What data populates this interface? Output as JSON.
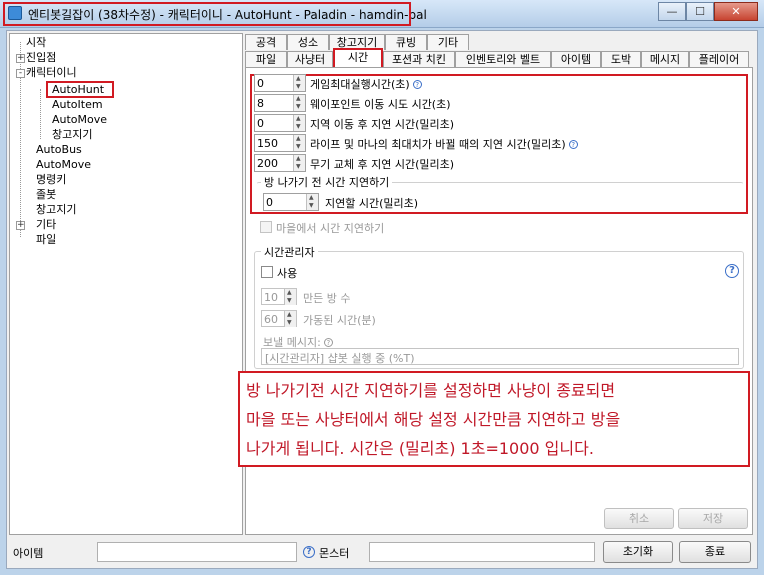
{
  "window": {
    "title": "엔티봇길잡이 (38차수정) - 캐릭터이니 - AutoHunt - Paladin - hamdin-pal",
    "min_label": "—",
    "max_label": "☐",
    "close_label": "✕"
  },
  "tree": {
    "items": [
      {
        "label": "시작"
      },
      {
        "label": "진입점",
        "expander": "+"
      },
      {
        "label": "캐릭터이니",
        "expander": "-"
      },
      {
        "label": "AutoHunt"
      },
      {
        "label": "AutoItem"
      },
      {
        "label": "AutoMove"
      },
      {
        "label": "창고지기"
      },
      {
        "label": "AutoBus"
      },
      {
        "label": "AutoMove"
      },
      {
        "label": "명령키"
      },
      {
        "label": "졸봇"
      },
      {
        "label": "창고지기"
      },
      {
        "label": "기타",
        "expander": "+"
      },
      {
        "label": "파일"
      }
    ]
  },
  "tabs": {
    "row1": [
      "공격",
      "성소",
      "창고지기",
      "큐빙",
      "기타"
    ],
    "row2": [
      "파일",
      "사냥터",
      "시간",
      "포션과 치킨",
      "인벤토리와 벨트",
      "아이템",
      "도박",
      "메시지",
      "플레이어"
    ],
    "active": "시간"
  },
  "settings": {
    "game_max_run": {
      "value": "0",
      "label": "게임최대실행시간(초)"
    },
    "waypoint_retry": {
      "value": "8",
      "label": "웨이포인트 이동 시도 시간(초)"
    },
    "area_move_delay": {
      "value": "0",
      "label": "지역 이동 후 지연 시간(밀리초)"
    },
    "life_mana_delay": {
      "value": "150",
      "label": "라이프 및 마나의 최대치가 바뀔 때의 지연 시간(밀리초)"
    },
    "weapon_swap_delay": {
      "value": "200",
      "label": "무기 교체 후 지연 시간(밀리초)"
    }
  },
  "leave_group": {
    "title": "방 나가기 전 시간 지연하기",
    "delay": {
      "value": "0",
      "label": "지연할 시간(밀리초)"
    }
  },
  "town_delay": {
    "label": "마을에서 시간 지연하기"
  },
  "time_manager": {
    "title": "시간관리자",
    "use_label": "사용",
    "help": "?",
    "minutes_bot": {
      "value": "10",
      "label": "만든 방 수"
    },
    "runtime": {
      "value": "60",
      "label": "가동된 시간(분)"
    },
    "message_label": "보낼 메시지:",
    "message_value": "[시간관리자] 샵봇 실행 중 (%T)"
  },
  "annotation": {
    "lines": [
      "방 나가기전 시간 지연하기를 설정하면 사냥이 종료되면",
      "마을 또는 사냥터에서 해당 설정 시간만큼 지연하고 방을",
      "나가게 됩니다. 시간은 (밀리초) 1초=1000 입니다."
    ]
  },
  "buttons": {
    "cancel": "취소",
    "save": "저장",
    "reset": "초기화",
    "close": "종료"
  },
  "status": {
    "item_label": "아이템",
    "monster_label": "몬스터",
    "help": "?"
  }
}
